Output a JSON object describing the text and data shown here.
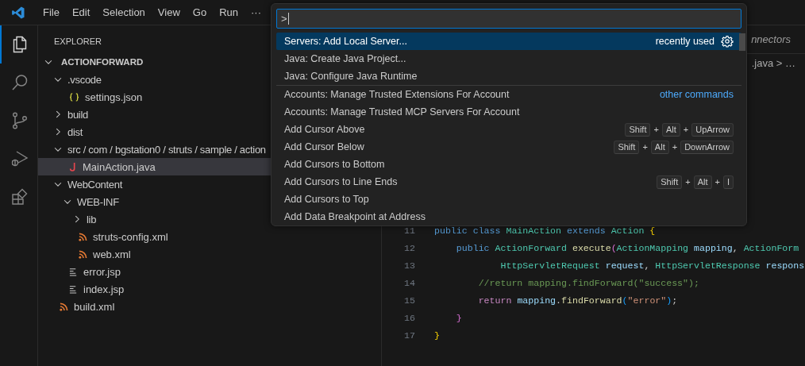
{
  "menu": [
    "File",
    "Edit",
    "Selection",
    "View",
    "Go",
    "Run",
    "···"
  ],
  "activity_bar": [
    {
      "kind": "files",
      "selected": true
    },
    {
      "kind": "search",
      "selected": false
    },
    {
      "kind": "source-control",
      "selected": false
    },
    {
      "kind": "run-debug",
      "selected": false
    },
    {
      "kind": "extensions",
      "selected": false
    }
  ],
  "explorer": {
    "title": "EXPLORER",
    "root": "ACTIONFORWARD",
    "tree": [
      {
        "label": ".vscode",
        "kind": "folder",
        "expanded": true,
        "selected": false,
        "children": [
          {
            "label": "settings.json",
            "kind": "json",
            "selected": false
          }
        ]
      },
      {
        "label": "build",
        "kind": "folder",
        "expanded": false,
        "selected": false
      },
      {
        "label": "dist",
        "kind": "folder",
        "expanded": false,
        "selected": false
      },
      {
        "label": "src / com / bgstation0 / struts / sample / action",
        "kind": "folder",
        "expanded": true,
        "selected": false,
        "children": [
          {
            "label": "MainAction.java",
            "kind": "java",
            "selected": true
          }
        ]
      },
      {
        "label": "WebContent",
        "kind": "folder",
        "expanded": true,
        "selected": false,
        "children": [
          {
            "label": "WEB-INF",
            "kind": "folder",
            "expanded": true,
            "selected": false,
            "children": [
              {
                "label": "lib",
                "kind": "folder",
                "expanded": false,
                "selected": false
              },
              {
                "label": "struts-config.xml",
                "kind": "xml",
                "selected": false
              },
              {
                "label": "web.xml",
                "kind": "xml",
                "selected": false
              }
            ]
          },
          {
            "label": "error.jsp",
            "kind": "text",
            "selected": false
          },
          {
            "label": "index.jsp",
            "kind": "text",
            "selected": false
          }
        ]
      },
      {
        "label": "build.xml",
        "kind": "xml",
        "selected": false
      }
    ]
  },
  "editor": {
    "tab": "nnectors",
    "breadcrumb": ".java > …",
    "lines": [
      {
        "number": "11",
        "tokens": [
          {
            "text": "public ",
            "kind": "keyword"
          },
          {
            "text": "class ",
            "kind": "keyword"
          },
          {
            "text": "MainAction ",
            "kind": "type"
          },
          {
            "text": "extends ",
            "kind": "keyword"
          },
          {
            "text": "Action ",
            "kind": "type"
          },
          {
            "text": "{",
            "kind": "bracket1"
          }
        ]
      },
      {
        "number": "12",
        "tokens": [
          {
            "text": "    public ",
            "kind": "keyword"
          },
          {
            "text": "ActionForward ",
            "kind": "type"
          },
          {
            "text": "execute",
            "kind": "function"
          },
          {
            "text": "(",
            "kind": "bracket2"
          },
          {
            "text": "ActionMapping ",
            "kind": "type"
          },
          {
            "text": "mapping",
            "kind": "variable"
          },
          {
            "text": ", ",
            "kind": "plain"
          },
          {
            "text": "ActionForm",
            "kind": "type"
          }
        ]
      },
      {
        "number": "13",
        "tokens": [
          {
            "text": "            HttpServletRequest ",
            "kind": "type"
          },
          {
            "text": "request",
            "kind": "variable"
          },
          {
            "text": ", ",
            "kind": "plain"
          },
          {
            "text": "HttpServletResponse ",
            "kind": "type"
          },
          {
            "text": "respons",
            "kind": "variable"
          }
        ]
      },
      {
        "number": "14",
        "tokens": [
          {
            "text": "        //return mapping.findForward(\"success\");",
            "kind": "comment"
          }
        ]
      },
      {
        "number": "15",
        "tokens": [
          {
            "text": "        return ",
            "kind": "control"
          },
          {
            "text": "mapping",
            "kind": "variable"
          },
          {
            "text": ".",
            "kind": "plain"
          },
          {
            "text": "findForward",
            "kind": "function"
          },
          {
            "text": "(",
            "kind": "bracket3"
          },
          {
            "text": "\"error\"",
            "kind": "string"
          },
          {
            "text": ")",
            "kind": "bracket3"
          },
          {
            "text": ";",
            "kind": "plain"
          }
        ]
      },
      {
        "number": "16",
        "tokens": [
          {
            "text": "    }",
            "kind": "bracket2"
          }
        ]
      },
      {
        "number": "17",
        "tokens": [
          {
            "text": "}",
            "kind": "bracket1"
          }
        ]
      }
    ]
  },
  "command_palette": {
    "input_value": ">",
    "commands": [
      {
        "label": "Servers: Add Local Server...",
        "selected": true,
        "note": "recently used",
        "gear": true,
        "separator_after": false
      },
      {
        "label": "Java: Create Java Project...",
        "selected": false,
        "separator_after": false
      },
      {
        "label": "Java: Configure Java Runtime",
        "selected": false,
        "separator_after": true
      },
      {
        "label": "Accounts: Manage Trusted Extensions For Account",
        "selected": false,
        "link": "other commands",
        "separator_after": false
      },
      {
        "label": "Accounts: Manage Trusted MCP Servers For Account",
        "selected": false,
        "separator_after": false
      },
      {
        "label": "Add Cursor Above",
        "selected": false,
        "keys": [
          {
            "text": "Shift",
            "kind": "key"
          },
          {
            "text": "+",
            "kind": "plus"
          },
          {
            "text": "Alt",
            "kind": "key"
          },
          {
            "text": "+",
            "kind": "plus"
          },
          {
            "text": "UpArrow",
            "kind": "key"
          }
        ],
        "separator_after": false
      },
      {
        "label": "Add Cursor Below",
        "selected": false,
        "keys": [
          {
            "text": "Shift",
            "kind": "key"
          },
          {
            "text": "+",
            "kind": "plus"
          },
          {
            "text": "Alt",
            "kind": "key"
          },
          {
            "text": "+",
            "kind": "plus"
          },
          {
            "text": "DownArrow",
            "kind": "key"
          }
        ],
        "separator_after": false
      },
      {
        "label": "Add Cursors to Bottom",
        "selected": false,
        "separator_after": false
      },
      {
        "label": "Add Cursors to Line Ends",
        "selected": false,
        "keys": [
          {
            "text": "Shift",
            "kind": "key"
          },
          {
            "text": "+",
            "kind": "plus"
          },
          {
            "text": "Alt",
            "kind": "key"
          },
          {
            "text": "+",
            "kind": "plus"
          },
          {
            "text": "I",
            "kind": "key"
          }
        ],
        "separator_after": false
      },
      {
        "label": "Add Cursors to Top",
        "selected": false,
        "separator_after": false
      },
      {
        "label": "Add Data Breakpoint at Address",
        "selected": false,
        "separator_after": false
      }
    ]
  }
}
